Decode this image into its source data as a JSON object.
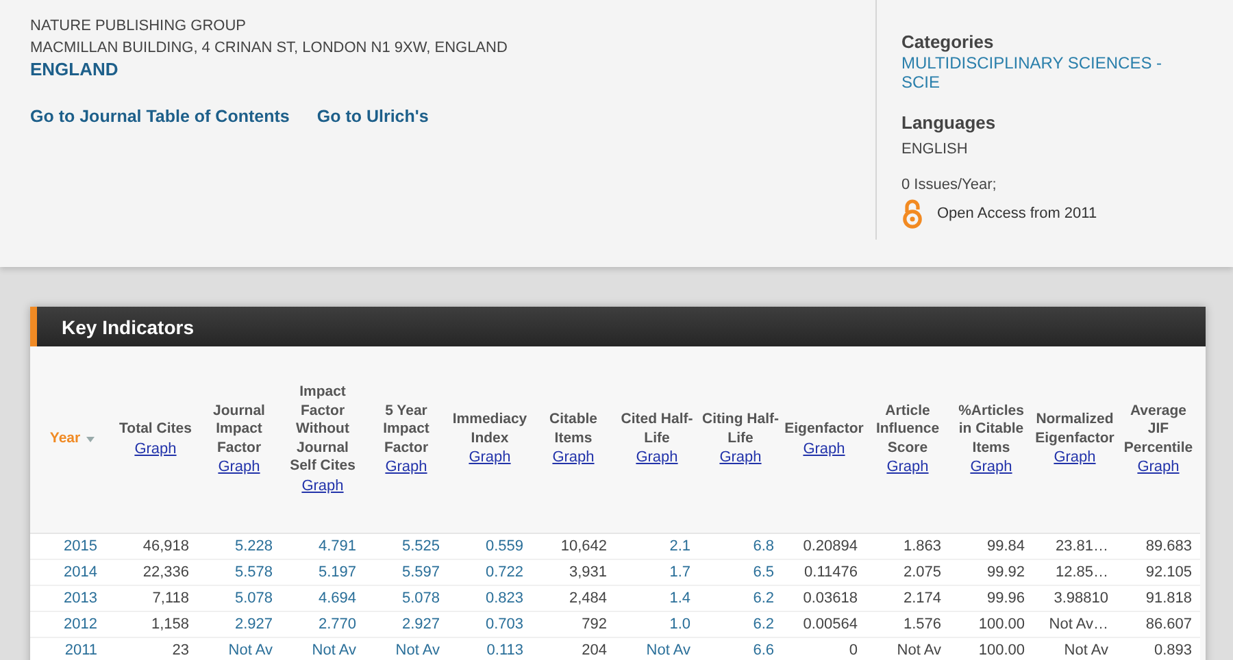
{
  "publisher": {
    "name": "NATURE PUBLISHING GROUP",
    "address": "MACMILLAN BUILDING, 4 CRINAN ST, LONDON N1 9XW, ENGLAND",
    "country": "ENGLAND"
  },
  "links": [
    "Go to Journal Table of Contents",
    "Go to Ulrich's"
  ],
  "details": {
    "categories_heading": "Categories",
    "category": "MULTIDISCIPLINARY SCIENCES - SCIE",
    "languages_heading": "Languages",
    "language": "ENGLISH",
    "issues": "0 Issues/Year;",
    "open_access": "Open Access from 2011"
  },
  "key_indicators": {
    "title": "Key Indicators",
    "columns": [
      {
        "label": "Year",
        "sorted": true,
        "linked": true
      },
      {
        "label": "Total Cites",
        "graph": "Graph",
        "sorted": false,
        "linked": false
      },
      {
        "label": "Journal Impact Factor",
        "graph": "Graph",
        "sorted": false,
        "linked": true
      },
      {
        "label": "Impact Factor Without Journal Self Cites",
        "graph": "Graph",
        "sorted": false,
        "linked": true
      },
      {
        "label": "5 Year Impact Factor",
        "graph": "Graph",
        "sorted": false,
        "linked": true
      },
      {
        "label": "Immediacy Index",
        "graph": "Graph",
        "sorted": false,
        "linked": true
      },
      {
        "label": "Citable Items",
        "graph": "Graph",
        "sorted": false,
        "linked": false
      },
      {
        "label": "Cited Half-Life",
        "graph": "Graph",
        "sorted": false,
        "linked": true
      },
      {
        "label": "Citing Half-Life",
        "graph": "Graph",
        "sorted": false,
        "linked": true
      },
      {
        "label": "Eigenfactor",
        "graph": "Graph",
        "sorted": false,
        "linked": false
      },
      {
        "label": "Article Influence Score",
        "graph": "Graph",
        "sorted": false,
        "linked": false
      },
      {
        "label": "%Articles in Citable Items",
        "graph": "Graph",
        "sorted": false,
        "linked": false
      },
      {
        "label": "Normalized Eigenfactor",
        "graph": "Graph",
        "sorted": false,
        "linked": false
      },
      {
        "label": "Average JIF Percentile",
        "graph": "Graph",
        "sorted": false,
        "linked": false
      }
    ],
    "rows": [
      [
        "2015",
        "46,918",
        "5.228",
        "4.791",
        "5.525",
        "0.559",
        "10,642",
        "2.1",
        "6.8",
        "0.20894",
        "1.863",
        "99.84",
        "23.81…",
        "89.683"
      ],
      [
        "2014",
        "22,336",
        "5.578",
        "5.197",
        "5.597",
        "0.722",
        "3,931",
        "1.7",
        "6.5",
        "0.11476",
        "2.075",
        "99.92",
        "12.85…",
        "92.105"
      ],
      [
        "2013",
        "7,118",
        "5.078",
        "4.694",
        "5.078",
        "0.823",
        "2,484",
        "1.4",
        "6.2",
        "0.03618",
        "2.174",
        "99.96",
        "3.98810",
        "91.818"
      ],
      [
        "2012",
        "1,158",
        "2.927",
        "2.770",
        "2.927",
        "0.703",
        "792",
        "1.0",
        "6.2",
        "0.00564",
        "1.576",
        "100.00",
        "Not Av…",
        "86.607"
      ],
      [
        "2011",
        "23",
        "Not Av",
        "Not Av",
        "Not Av",
        "0.113",
        "204",
        "Not Av",
        "6.6",
        "0",
        "Not Av",
        "100.00",
        "Not Av",
        "0.893"
      ]
    ]
  }
}
